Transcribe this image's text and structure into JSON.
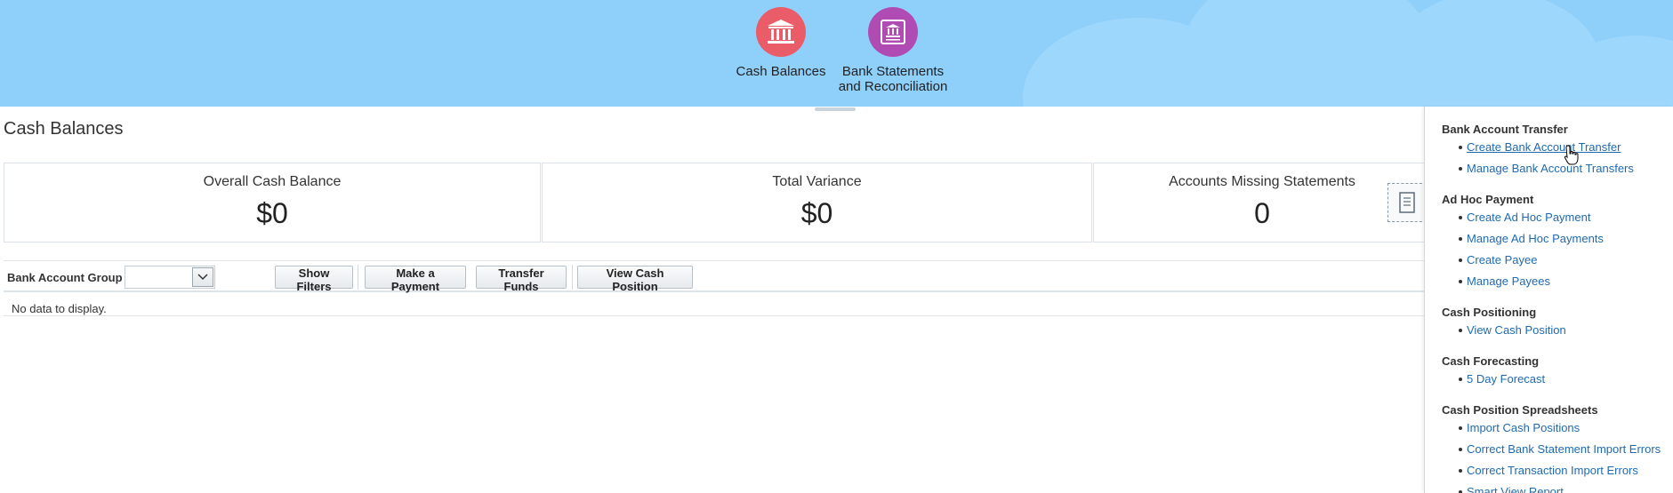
{
  "header": {
    "apps": [
      {
        "label": "Cash Balances",
        "icon": "bank-icon",
        "color": "#ea5c67"
      },
      {
        "label_line1": "Bank Statements",
        "label_line2": "and Reconciliation",
        "icon": "bank-statement-icon",
        "color": "#b04bb4"
      }
    ]
  },
  "main": {
    "title": "Cash Balances",
    "tiles": [
      {
        "label": "Overall Cash Balance",
        "value": "$0"
      },
      {
        "label": "Total Variance",
        "value": "$0"
      },
      {
        "label": "Accounts Missing Statements",
        "value": "0"
      }
    ],
    "toolbar": {
      "group_label": "Bank Account Group",
      "group_value": "",
      "buttons": [
        "Show Filters",
        "Make a Payment",
        "Transfer Funds",
        "View Cash Position"
      ]
    },
    "empty_text": "No data to display."
  },
  "panel": {
    "groups": [
      {
        "title": "Bank Account Transfer",
        "links": [
          "Create Bank Account Transfer",
          "Manage Bank Account Transfers"
        ]
      },
      {
        "title": "Ad Hoc Payment",
        "links": [
          "Create Ad Hoc Payment",
          "Manage Ad Hoc Payments",
          "Create Payee",
          "Manage Payees"
        ]
      },
      {
        "title": "Cash Positioning",
        "links": [
          "View Cash Position"
        ]
      },
      {
        "title": "Cash Forecasting",
        "links": [
          "5 Day Forecast"
        ]
      },
      {
        "title": "Cash Position Spreadsheets",
        "links": [
          "Import Cash Positions",
          "Correct Bank Statement Import Errors",
          "Correct Transaction Import Errors",
          "Smart View Report"
        ]
      }
    ]
  },
  "colors": {
    "banner": "#8fd0fb",
    "link": "#1f6ab0"
  }
}
